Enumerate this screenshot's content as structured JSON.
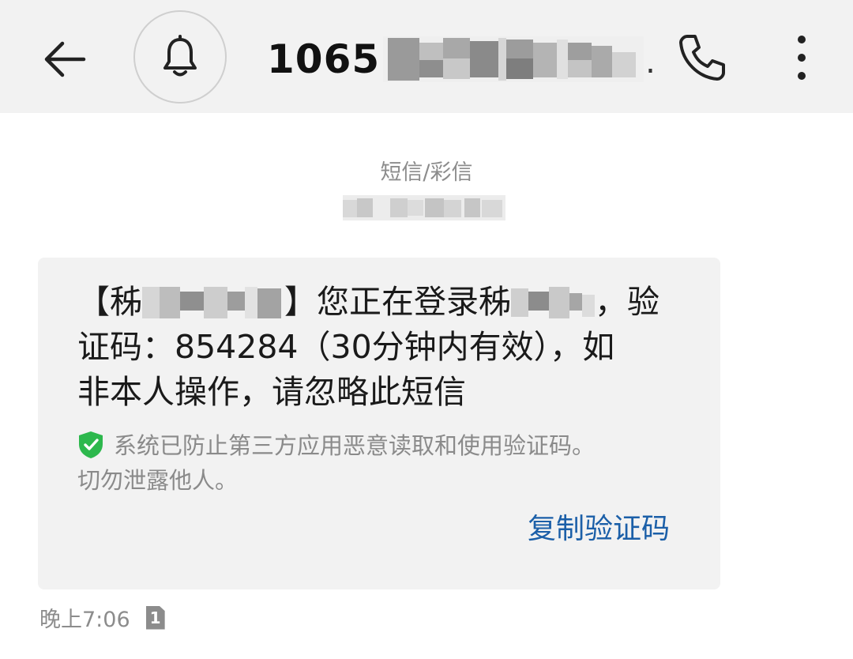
{
  "header": {
    "back_icon": "back-arrow-icon",
    "bell_icon": "bell-icon",
    "sender_prefix": "1065",
    "sender_ellipsis": ".",
    "call_icon": "phone-icon",
    "more_icon": "more-vertical-icon"
  },
  "thread": {
    "message_type": "短信/彩信"
  },
  "message": {
    "line1_open": "【秭",
    "line1_close": "】您正在登录秭",
    "line1_end": "，验",
    "line2": "证码：854284（30分钟内有效），如",
    "line3": "非本人操作，请忽略此短信",
    "code": "854284"
  },
  "protection": {
    "icon": "shield-check-icon",
    "text_line1": "系统已防止第三方应用恶意读取和使用验证码。",
    "text_line2": "切勿泄露他人。"
  },
  "actions": {
    "copy_code": "复制验证码"
  },
  "meta": {
    "time": "晚上7:06",
    "sim_slot": "1"
  },
  "colors": {
    "header_bg": "#f2f2f2",
    "bubble_bg": "#f2f2f2",
    "link": "#1b5fa8",
    "shield": "#2db84d"
  }
}
